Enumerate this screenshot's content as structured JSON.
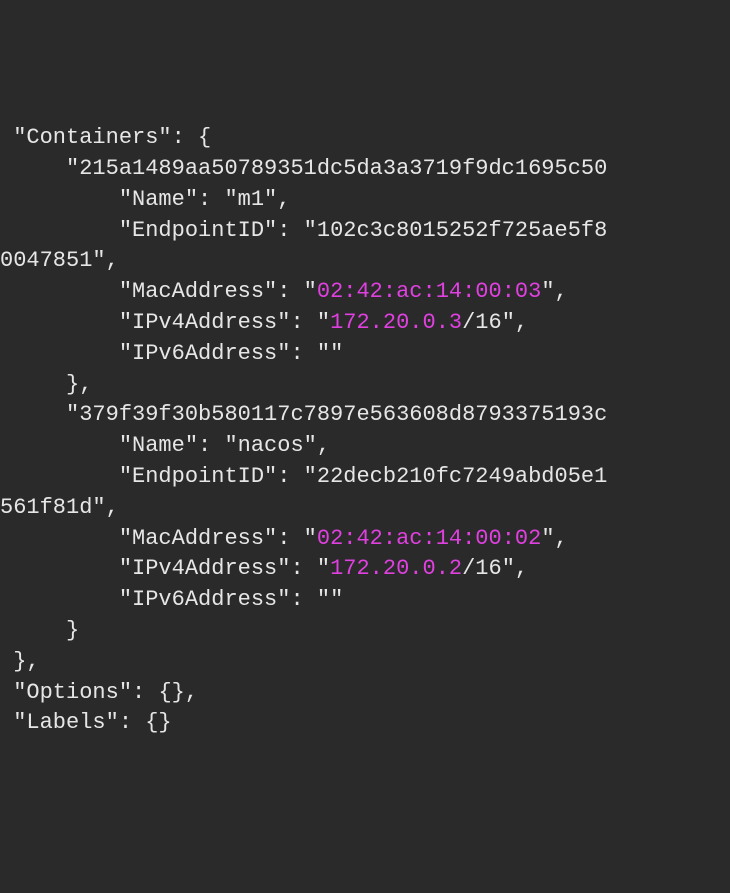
{
  "json_output": {
    "containers_key": "\"Containers\"",
    "container1": {
      "id": "\"215a1489aa50789351dc5da3a3719f9dc1695c50",
      "name_key": "\"Name\"",
      "name_val": "\"m1\"",
      "endpoint_key": "\"EndpointID\"",
      "endpoint_val": "\"102c3c8015252f725ae5f8",
      "endpoint_cont": "0047851\"",
      "mac_key": "\"MacAddress\"",
      "mac_val": "02:42:ac:14:00:03",
      "ipv4_key": "\"IPv4Address\"",
      "ipv4_val": "172.20.0.3",
      "ipv4_suffix": "/16",
      "ipv6_key": "\"IPv6Address\"",
      "ipv6_val": "\"\""
    },
    "container2": {
      "id": "\"379f39f30b580117c7897e563608d8793375193c",
      "name_key": "\"Name\"",
      "name_val": "\"nacos\"",
      "endpoint_key": "\"EndpointID\"",
      "endpoint_val": "\"22decb210fc7249abd05e1",
      "endpoint_cont": "561f81d\"",
      "mac_key": "\"MacAddress\"",
      "mac_val": "02:42:ac:14:00:02",
      "ipv4_key": "\"IPv4Address\"",
      "ipv4_val": "172.20.0.2",
      "ipv4_suffix": "/16",
      "ipv6_key": "\"IPv6Address\"",
      "ipv6_val": "\"\""
    },
    "options_key": "\"Options\"",
    "options_val": "{}",
    "labels_key": "\"Labels\"",
    "labels_val": "{}"
  }
}
